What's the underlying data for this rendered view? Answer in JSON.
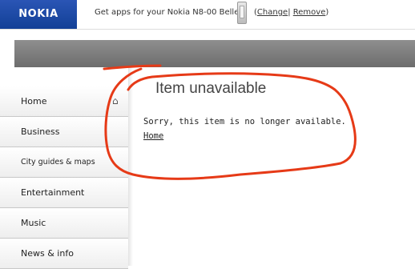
{
  "header": {
    "logo_text": "NOKIA",
    "promo_text": "Get apps for your Nokia N8-00 Belle",
    "open_paren": "(",
    "change_label": "Change",
    "separator": "|",
    "remove_label": "Remove",
    "close_paren": ")"
  },
  "sidebar": {
    "items": [
      {
        "label": "Home",
        "icon": "home-icon"
      },
      {
        "label": "Business"
      },
      {
        "label": "City guides & maps"
      },
      {
        "label": "Entertainment"
      },
      {
        "label": "Music"
      },
      {
        "label": "News & info"
      }
    ]
  },
  "main": {
    "title": "Item unavailable",
    "message": "Sorry, this item is no longer available.",
    "home_link": "Home"
  },
  "colors": {
    "brand_blue": "#1f4ba8",
    "annotation_red": "#e63a17",
    "header_bar_grey": "#7d7d7d"
  }
}
